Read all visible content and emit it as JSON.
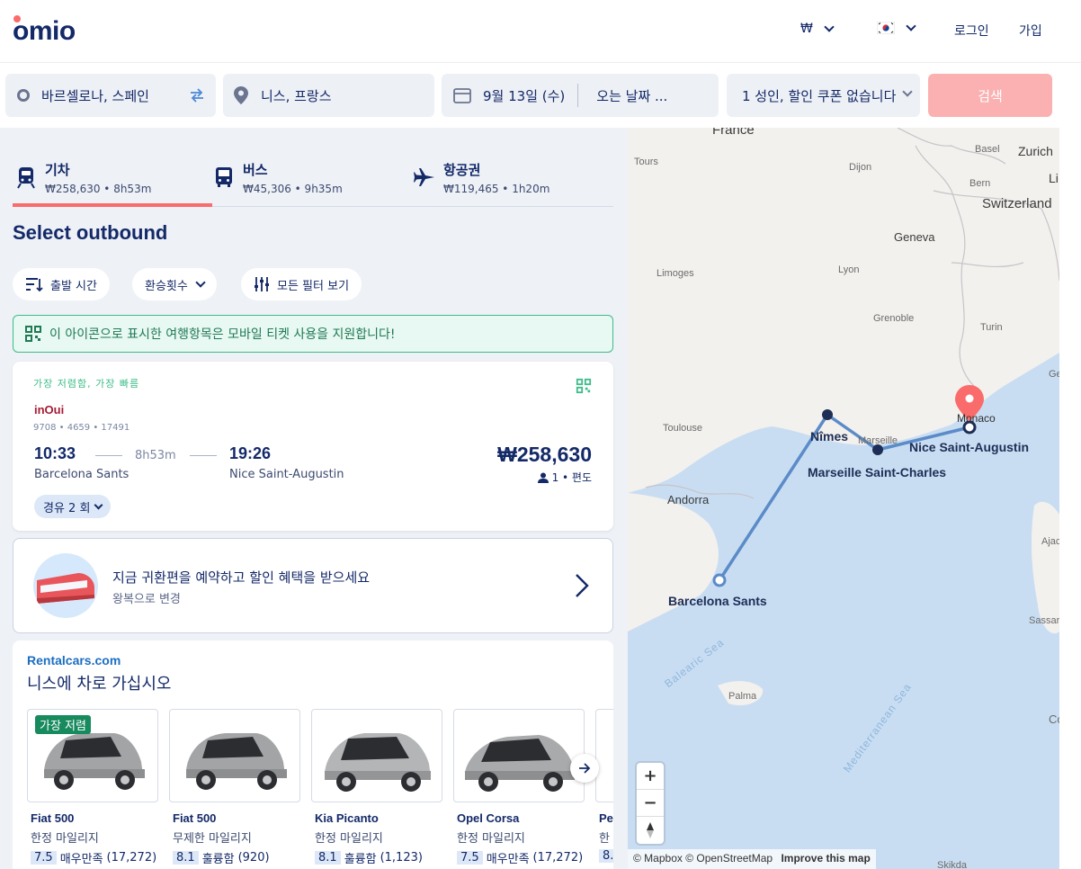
{
  "header": {
    "logo": "omio",
    "currency": "₩",
    "login": "로그인",
    "signup": "가입"
  },
  "search": {
    "from": "바르셀로나, 스페인",
    "to": "니스, 프랑스",
    "depart_date": "9월 13일 (수)",
    "return_placeholder": "오는 날짜 ...",
    "passengers": "1 성인, 할인 쿠폰 없습니다",
    "search_button": "검색"
  },
  "tabs": [
    {
      "label": "기차",
      "summary": "₩258,630 • 8h53m",
      "icon": "train-icon"
    },
    {
      "label": "버스",
      "summary": "₩45,306 • 9h35m",
      "icon": "bus-icon"
    },
    {
      "label": "항공권",
      "summary": "₩119,465 • 1h20m",
      "icon": "plane-icon"
    }
  ],
  "page_title": "Select outbound",
  "filters": {
    "departure_time": "출발 시간",
    "transfers": "환승횟수",
    "all_filters": "모든 필터 보기"
  },
  "mobile_ticket_notice": "이 아이콘으로 표시한 여행항목은 모바일 티켓 사용을 지원합니다!",
  "journey": {
    "badge": "가장 저렴함, 가장 빠름",
    "carrier": "inOui",
    "train_numbers": "9708 • 4659 • 17491",
    "depart_time": "10:33",
    "depart_station": "Barcelona Sants",
    "duration": "8h53m",
    "arrive_time": "19:26",
    "arrive_station": "Nice Saint-Augustin",
    "price": "₩258,630",
    "passenger_info": "1 • 편도",
    "stops": "경유 2 회"
  },
  "return_promo": {
    "title": "지금 귀환편을 예약하고 할인 혜택을 받으세요",
    "subtitle": "왕복으로 변경"
  },
  "rental": {
    "brand": "Rentalcars.com",
    "title": "니스에 차로 가십시오",
    "cheapest_tag": "가장 저렴",
    "cars": [
      {
        "name": "Fiat 500",
        "mileage": "한정 마일리지",
        "score": "7.5",
        "rating": "매우만족",
        "reviews": "(17,272)"
      },
      {
        "name": "Fiat 500",
        "mileage": "무제한 마일리지",
        "score": "8.1",
        "rating": "훌륭함",
        "reviews": "(920)"
      },
      {
        "name": "Kia Picanto",
        "mileage": "한정 마일리지",
        "score": "8.1",
        "rating": "훌륭함",
        "reviews": "(1,123)"
      },
      {
        "name": "Opel Corsa",
        "mileage": "한정 마일리지",
        "score": "7.5",
        "rating": "매우만족",
        "reviews": "(17,272)"
      },
      {
        "name": "Pe",
        "mileage": "한",
        "score": "8.",
        "rating": "",
        "reviews": ""
      }
    ]
  },
  "map": {
    "labels": {
      "france": "France",
      "tours": "Tours",
      "dijon": "Dijon",
      "basel": "Basel",
      "zurich": "Zurich",
      "bern": "Bern",
      "switzerland": "Switzerland",
      "li": "Li",
      "geneva": "Geneva",
      "limoges": "Limoges",
      "lyon": "Lyon",
      "grenoble": "Grenoble",
      "turin": "Turin",
      "gen": "Gen",
      "toulouse": "Toulouse",
      "monaco": "Monaco",
      "marseille": "Marseille",
      "andorra": "Andorra",
      "ajaccio": "Ajaccio",
      "sassari": "Sassari",
      "palma": "Palma",
      "co": "Co",
      "skikda": "Skikda",
      "balearic": "Balearic Sea",
      "mediterranean": "Mediterranean Sea"
    },
    "stations": {
      "barcelona": "Barcelona Sants",
      "nimes": "Nîmes",
      "marseille": "Marseille Saint-Charles",
      "nice": "Nice Saint-Augustin"
    },
    "zoom_in": "+",
    "zoom_out": "−",
    "attribution": "© Mapbox © OpenStreetMap",
    "improve": "Improve this map"
  },
  "colors": {
    "brand_navy": "#132968",
    "accent_coral": "#fa6b6b",
    "search_button_disabled": "#fbb1b1",
    "route_line": "#5b8bc8",
    "notice_green": "#3dbc89"
  }
}
